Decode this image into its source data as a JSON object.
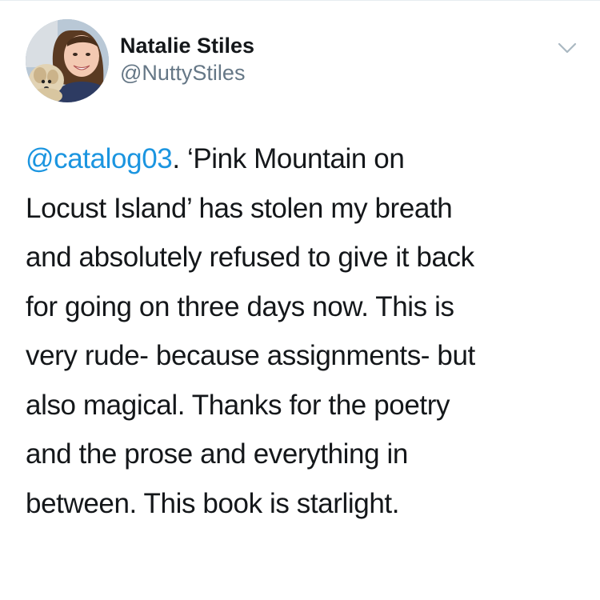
{
  "user": {
    "display_name": "Natalie Stiles",
    "handle": "@NuttyStiles"
  },
  "icons": {
    "menu": "chevron-down-icon",
    "avatar": "avatar-photo"
  },
  "colors": {
    "mention": "#1b95e0",
    "text": "#14171a",
    "secondary": "#657786",
    "chevron": "#aab8c2"
  },
  "tweet": {
    "mention": "@catalog03",
    "lines": [
      ". ‘Pink Mountain on",
      "Locust Island’ has stolen my breath",
      "and absolutely refused to give it back",
      "for going on three days now. This is",
      "very rude- because assignments- but",
      "also magical. Thanks for the poetry",
      "and the prose and everything in",
      "between. This book is starlight."
    ]
  }
}
